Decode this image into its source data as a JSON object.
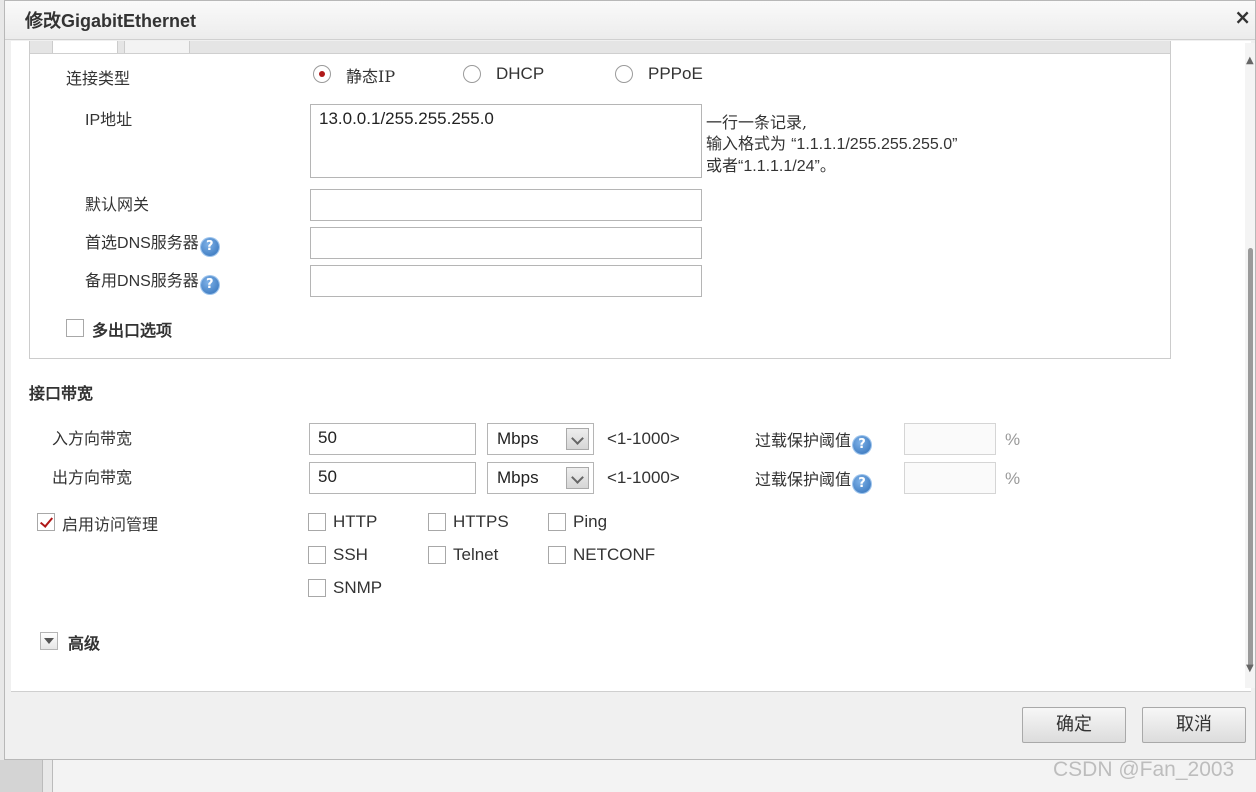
{
  "window": {
    "title": "修改GigabitEthernet",
    "close_symbol": "×"
  },
  "connection": {
    "label": "连接类型",
    "options": [
      {
        "label": "静态IP",
        "selected": true
      },
      {
        "label": "DHCP",
        "selected": false
      },
      {
        "label": "PPPoE",
        "selected": false
      }
    ]
  },
  "ip": {
    "label": "IP地址",
    "value": "13.0.0.1/255.255.255.0",
    "hint_line1": "一行一条记录,",
    "hint_line2_prefix": "输入格式为 ",
    "hint_line2_value": "“1.1.1.1/255.255.255.0”",
    "hint_line3_prefix": "或者",
    "hint_line3_value": "“1.1.1.1/24”",
    "hint_line3_suffix": "。"
  },
  "gateway": {
    "label": "默认网关",
    "value": ""
  },
  "dns_primary": {
    "label_prefix": "首选",
    "label_mid": "DNS",
    "label_suffix": "服务器",
    "value": ""
  },
  "dns_backup": {
    "label_prefix": "备用",
    "label_mid": "DNS",
    "label_suffix": "服务器",
    "value": ""
  },
  "multi_egress": {
    "label": "多出口选项",
    "checked": false
  },
  "bandwidth": {
    "section_title": "接口带宽",
    "inbound": {
      "label": "入方向带宽",
      "value": "50",
      "unit": "Mbps",
      "range": "<1-1000>",
      "overload_label": "过载保护阈值",
      "overload_value": "",
      "percent": "%"
    },
    "outbound": {
      "label": "出方向带宽",
      "value": "50",
      "unit": "Mbps",
      "range": "<1-1000>",
      "overload_label": "过载保护阈值",
      "overload_value": "",
      "percent": "%"
    }
  },
  "access": {
    "label": "启用访问管理",
    "checked": true,
    "services": [
      {
        "label": "HTTP",
        "checked": false
      },
      {
        "label": "HTTPS",
        "checked": false
      },
      {
        "label": "Ping",
        "checked": false
      },
      {
        "label": "SSH",
        "checked": false
      },
      {
        "label": "Telnet",
        "checked": false
      },
      {
        "label": "NETCONF",
        "checked": false
      },
      {
        "label": "SNMP",
        "checked": false
      }
    ]
  },
  "advanced": {
    "label": "高级"
  },
  "help_symbol": "?",
  "footer": {
    "ok": "确定",
    "cancel": "取消"
  },
  "watermark": "CSDN @Fan_2003",
  "colors": {
    "accent_red": "#b01818",
    "help_blue": "#2f6fb8"
  }
}
